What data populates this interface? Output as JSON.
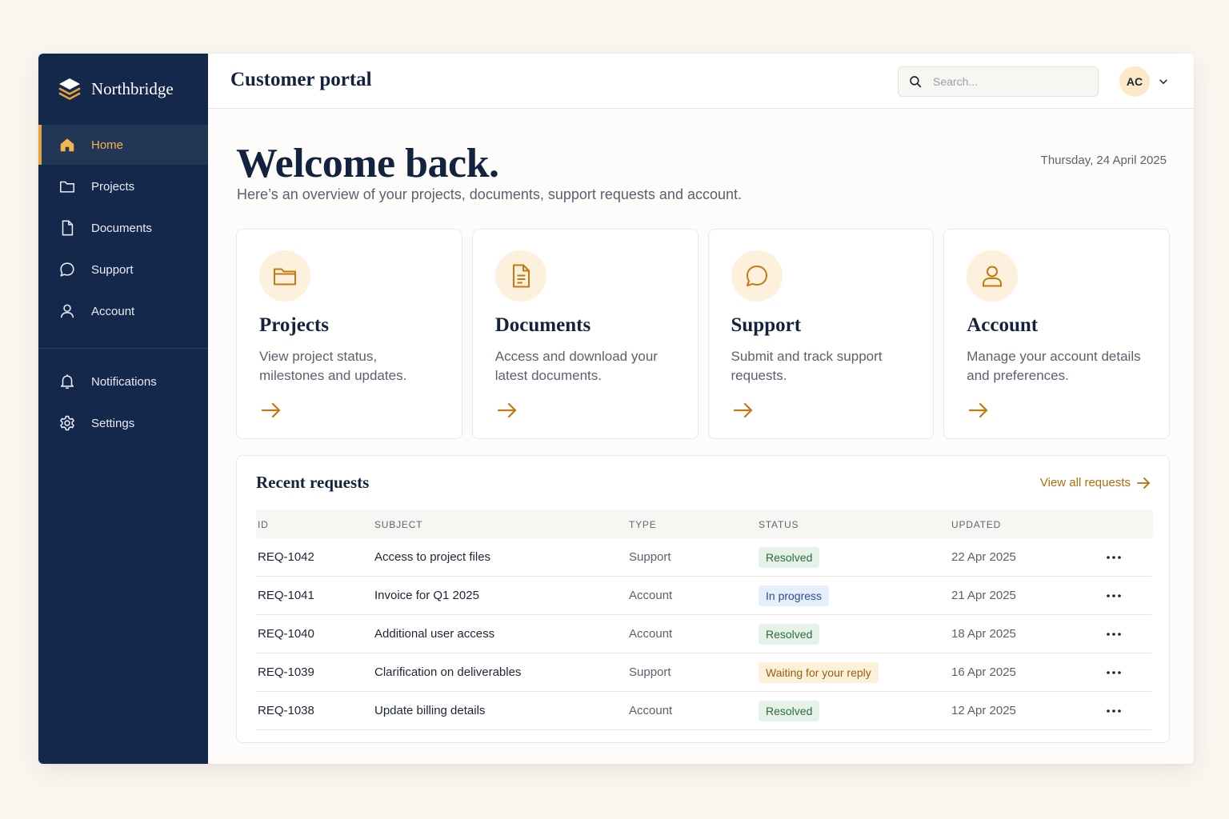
{
  "brand": {
    "name": "Northbridge",
    "logo": "layers-logo-icon"
  },
  "sidebar": {
    "main": [
      {
        "label": "Home",
        "icon": "home-icon",
        "active": true
      },
      {
        "label": "Projects",
        "icon": "folder-icon"
      },
      {
        "label": "Documents",
        "icon": "document-icon"
      },
      {
        "label": "Support",
        "icon": "chat-bubble-icon"
      },
      {
        "label": "Account",
        "icon": "user-icon"
      }
    ],
    "secondary": [
      {
        "label": "Notifications",
        "icon": "bell-icon"
      },
      {
        "label": "Settings",
        "icon": "gear-icon"
      }
    ]
  },
  "header": {
    "title": "Customer portal",
    "search_placeholder": "Search...",
    "avatar_initials": "AC"
  },
  "welcome": {
    "heading": "Welcome back.",
    "subtitle": "Here’s an overview of your projects, documents, support requests and account.",
    "date": "Thursday, 24 April 2025"
  },
  "cards": [
    {
      "title": "Projects",
      "description": "View project status, milestones and updates.",
      "icon": "folder-icon"
    },
    {
      "title": "Documents",
      "description": "Access and download your latest documents.",
      "icon": "document-icon"
    },
    {
      "title": "Support",
      "description": "Submit and track support requests.",
      "icon": "chat-bubble-icon"
    },
    {
      "title": "Account",
      "description": "Manage your account details and preferences.",
      "icon": "user-icon"
    }
  ],
  "requests": {
    "title": "Recent requests",
    "view_all": "View all requests",
    "columns": {
      "id": "ID",
      "subject": "SUBJECT",
      "type": "TYPE",
      "status": "STATUS",
      "updated": "UPDATED"
    },
    "rows": [
      {
        "id": "REQ-1042",
        "subject": "Access to project files",
        "type": "Support",
        "status": "Resolved",
        "updated": "22 Apr 2025"
      },
      {
        "id": "REQ-1041",
        "subject": "Invoice for Q1 2025",
        "type": "Account",
        "status": "In progress",
        "updated": "21 Apr 2025"
      },
      {
        "id": "REQ-1040",
        "subject": "Additional user access",
        "type": "Account",
        "status": "Resolved",
        "updated": "18 Apr 2025"
      },
      {
        "id": "REQ-1039",
        "subject": "Clarification on deliverables",
        "type": "Support",
        "status": "Waiting for your reply",
        "updated": "16 Apr 2025"
      },
      {
        "id": "REQ-1038",
        "subject": "Update billing details",
        "type": "Account",
        "status": "Resolved",
        "updated": "12 Apr 2025"
      }
    ]
  },
  "colors": {
    "sidebar_bg": "#13284a",
    "accent": "#e6a43a",
    "accent_text": "#b56d08",
    "status_resolved": "#e6f2e8",
    "status_in_progress": "#e6eefb",
    "status_waiting": "#fdf0d9"
  }
}
